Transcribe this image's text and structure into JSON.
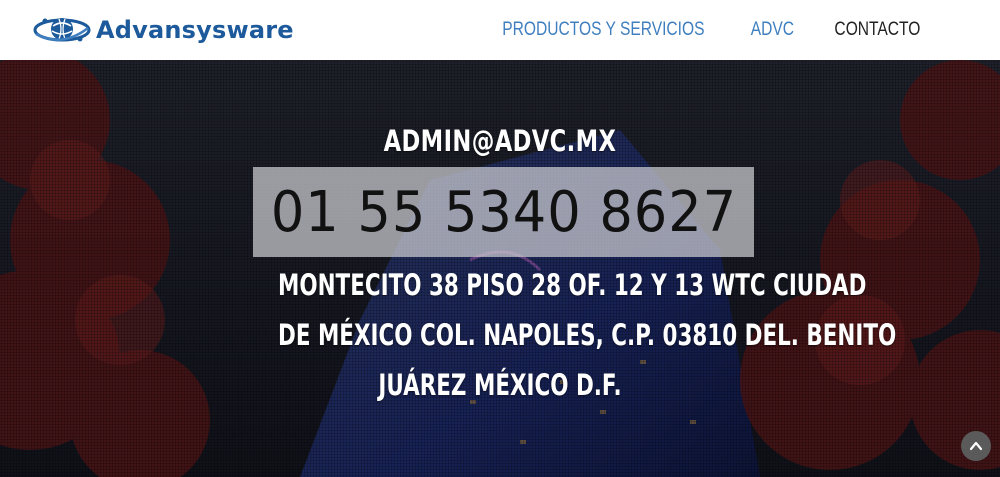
{
  "brand": {
    "name": "Advansysware",
    "logo_icon": "globe-swoosh-icon",
    "color": "#1c5a9b"
  },
  "nav": {
    "items": [
      {
        "label": "PRODUCTOS Y SERVICIOS",
        "color": "#3f7fbf"
      },
      {
        "label": "ADVC",
        "color": "#3f7fbf"
      },
      {
        "label": "CONTACTO",
        "color": "#222222"
      }
    ]
  },
  "contact": {
    "email": "ADMIN@ADVC.MX",
    "phone": "01 55 5340 8627",
    "address_lines": [
      "MONTECITO 38 PISO 28 OF. 12 Y 13 WTC CIUDAD",
      "DE MÉXICO COL. NAPOLES, C.P. 03810 DEL. BENITO",
      "JUÁREZ MÉXICO D.F."
    ]
  },
  "scroll_top": {
    "icon": "chevron-up-icon"
  }
}
